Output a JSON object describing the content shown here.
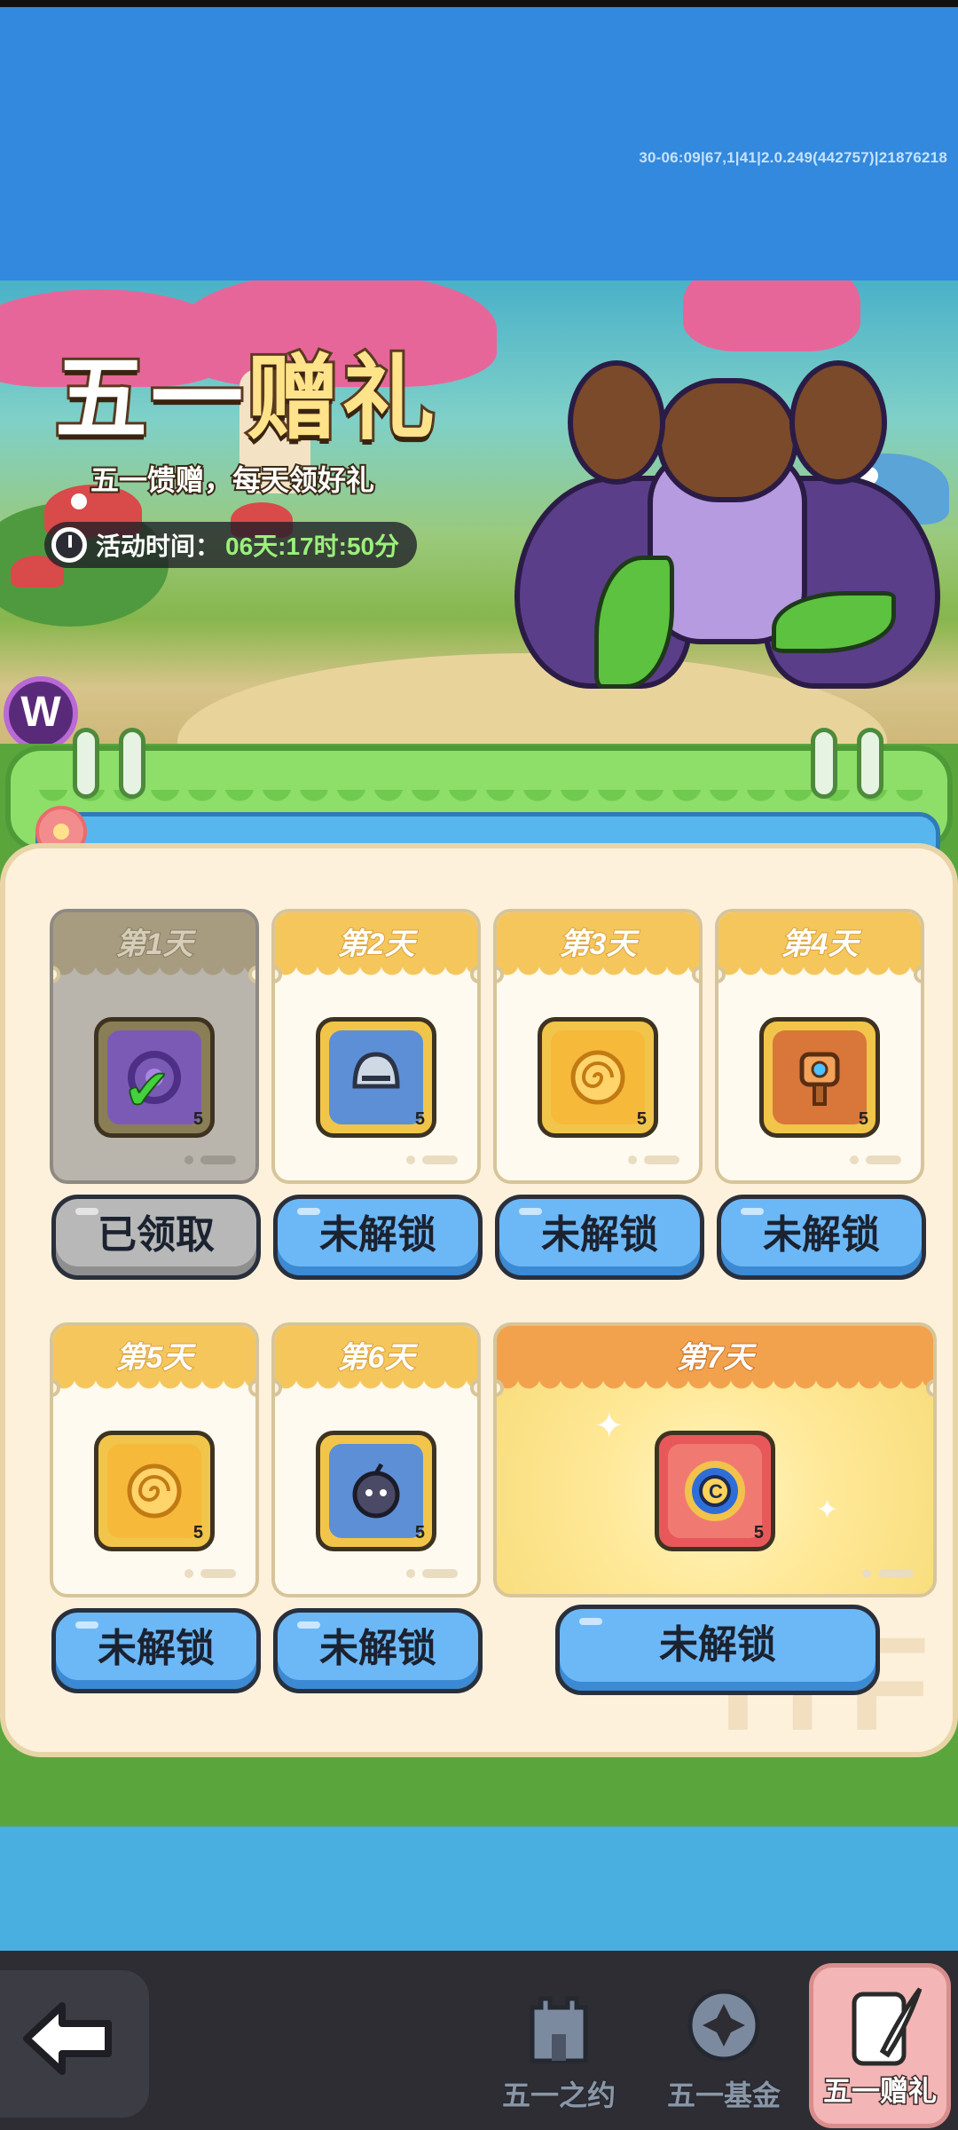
{
  "debug_text": "30-06:09|67,1|41|2.0.249(442757)|21876218",
  "banner": {
    "title_part1": "五一",
    "title_part2": "赠礼",
    "subtitle": "五一馈赠，每天领好礼",
    "timer_label": "活动时间：",
    "timer_value": "06天:17时:50分",
    "badge_letter": "W"
  },
  "rewards": [
    {
      "day": "第1天",
      "quantity": "5",
      "icon": "purple-card-icon",
      "status": "已领取",
      "claimed": true
    },
    {
      "day": "第2天",
      "quantity": "5",
      "icon": "knight-helmet-icon",
      "status": "未解锁",
      "claimed": false
    },
    {
      "day": "第3天",
      "quantity": "5",
      "icon": "golden-swirl-icon",
      "status": "未解锁",
      "claimed": false
    },
    {
      "day": "第4天",
      "quantity": "5",
      "icon": "orange-totem-icon",
      "status": "未解锁",
      "claimed": false
    },
    {
      "day": "第5天",
      "quantity": "5",
      "icon": "golden-swirl-icon",
      "status": "未解锁",
      "claimed": false
    },
    {
      "day": "第6天",
      "quantity": "5",
      "icon": "bomb-creature-icon",
      "status": "未解锁",
      "claimed": false
    },
    {
      "day": "第7天",
      "quantity": "5",
      "icon": "compass-coin-icon",
      "status": "未解锁",
      "claimed": false
    }
  ],
  "board_watermark": "ITF",
  "nav": {
    "back_icon": "back-arrow-icon",
    "tabs": [
      {
        "label": "五一之约",
        "icon": "castle-icon",
        "active": false
      },
      {
        "label": "五一基金",
        "icon": "gear-coin-icon",
        "active": false
      },
      {
        "label": "五一赠礼",
        "icon": "scroll-quill-icon",
        "active": true
      }
    ]
  },
  "colors": {
    "sky_blue": "#3289dd",
    "button_blue": "#6cb8f7",
    "card_header": "#f5c65c",
    "big_card_header": "#f2a14d",
    "timer_green": "#9bf07a",
    "active_tab": "#f3b5b5"
  }
}
